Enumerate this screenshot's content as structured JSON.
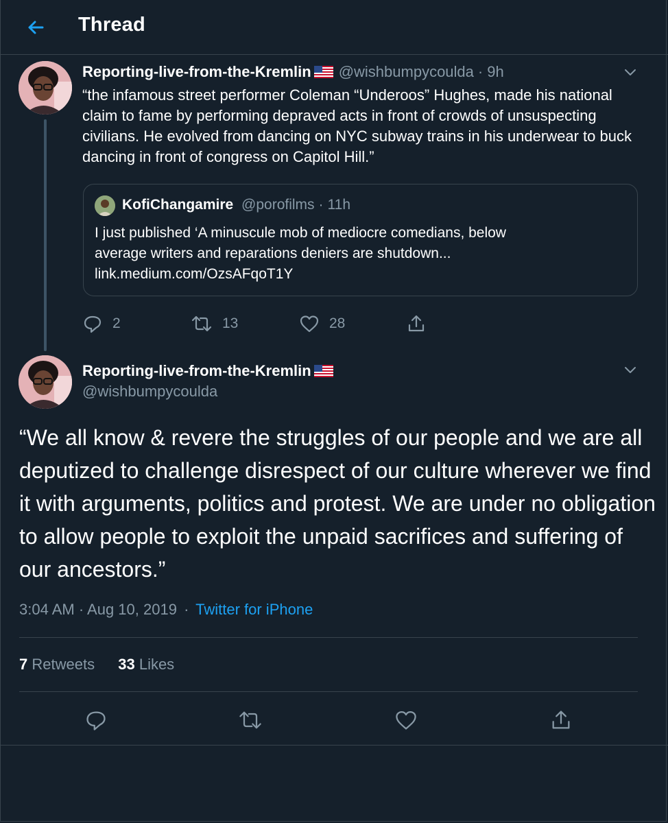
{
  "header": {
    "title": "Thread"
  },
  "reply_tweet": {
    "display_name": "Reporting-live-from-the-Kremlin",
    "handle": "@wishbumpycoulda",
    "separator": "·",
    "time": "9h",
    "text": "“the infamous street performer Coleman “Underoos” Hughes, made his national claim to fame by performing depraved acts in front of crowds of unsuspecting civilians. He evolved from dancing on NYC subway trains in his underwear to buck dancing in front of congress on Capitol Hill.”",
    "quote": {
      "display_name": "KofiChangamire",
      "handle": "@porofilms",
      "separator": "·",
      "time": "11h",
      "text_line1": "I just published ‘A minuscule mob of mediocre comedians, below",
      "text_line2": "average writers and reparations deniers are shutdown...",
      "link": "link.medium.com/OzsAFqoT1Y"
    },
    "actions": {
      "replies": "2",
      "retweets": "13",
      "likes": "28"
    }
  },
  "main_tweet": {
    "display_name": "Reporting-live-from-the-Kremlin",
    "handle": "@wishbumpycoulda",
    "text": "“We all know & revere the struggles of our people and we are all deputized to challenge disrespect of our culture wherever we find it with arguments, politics and protest. We are under no obligation to allow people to exploit the unpaid sacrifices and suffering of our ancestors.”",
    "timestamp": "3:04 AM · Aug 10, 2019",
    "meta_separator": "·",
    "source": "Twitter for iPhone",
    "retweet_count": "7",
    "retweet_label": "Retweets",
    "like_count": "33",
    "like_label": "Likes"
  },
  "icons": {
    "back": "arrow-left-icon",
    "chevron": "chevron-down-icon",
    "flag": "us-flag-icon",
    "reply": "reply-bubble-icon",
    "retweet": "retweet-icon",
    "like": "heart-icon",
    "share": "share-icon"
  },
  "colors": {
    "background": "#15202b",
    "accent": "#1da1f2",
    "muted": "#8899a6",
    "border": "#38444d"
  }
}
